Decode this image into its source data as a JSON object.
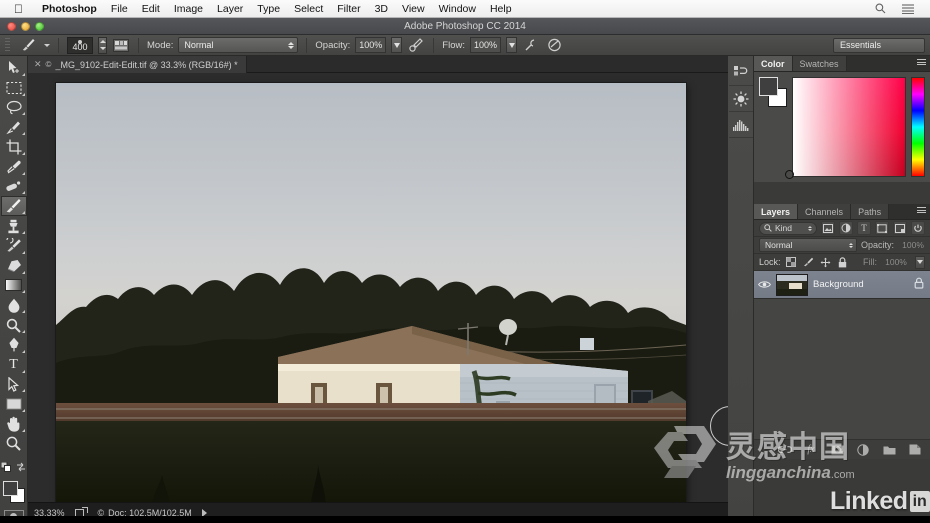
{
  "menubar": {
    "apple_icon": "apple-icon",
    "items": [
      "Photoshop",
      "File",
      "Edit",
      "Image",
      "Layer",
      "Type",
      "Select",
      "Filter",
      "3D",
      "View",
      "Window",
      "Help"
    ],
    "right_icons": [
      "search-icon",
      "list-menu-icon"
    ]
  },
  "window": {
    "title": "Adobe Photoshop CC 2014",
    "traffic_lights": [
      "close-button",
      "minimize-button",
      "zoom-button"
    ]
  },
  "options_bar": {
    "tool_icon": "brush-tool-icon",
    "brush_size": "400",
    "brush_preset_icon": "brush-preset-panel-icon",
    "mode_label": "Mode:",
    "mode_value": "Normal",
    "opacity_label": "Opacity:",
    "opacity_value": "100%",
    "pressure_opacity_icon": "airbrush-pressure-opacity-icon",
    "flow_label": "Flow:",
    "flow_value": "100%",
    "airbrush_icon": "airbrush-icon",
    "smoothing_icon": "pressure-size-icon",
    "workspace": "Essentials"
  },
  "document_tab": {
    "close_icon": "close-tab-icon",
    "copyright_mark": "©",
    "title": "_MG_9102-Edit-Edit.tif @ 33.3% (RGB/16#) *"
  },
  "tools": [
    {
      "name": "move-tool",
      "glyph": "move",
      "selected": false
    },
    {
      "name": "rectangular-marquee-tool",
      "glyph": "marquee",
      "selected": false
    },
    {
      "name": "lasso-tool",
      "glyph": "lasso",
      "selected": false
    },
    {
      "name": "quick-selection-tool",
      "glyph": "quickselect",
      "selected": false
    },
    {
      "name": "crop-tool",
      "glyph": "crop",
      "selected": false
    },
    {
      "name": "eyedropper-tool",
      "glyph": "eyedropper",
      "selected": false
    },
    {
      "name": "spot-healing-brush-tool",
      "glyph": "healing",
      "selected": false
    },
    {
      "name": "brush-tool",
      "glyph": "brush",
      "selected": true
    },
    {
      "name": "clone-stamp-tool",
      "glyph": "stamp",
      "selected": false
    },
    {
      "name": "history-brush-tool",
      "glyph": "historybrush",
      "selected": false
    },
    {
      "name": "eraser-tool",
      "glyph": "eraser",
      "selected": false
    },
    {
      "name": "gradient-tool",
      "glyph": "gradient",
      "selected": false
    },
    {
      "name": "blur-tool",
      "glyph": "blur",
      "selected": false
    },
    {
      "name": "dodge-tool",
      "glyph": "dodge",
      "selected": false
    },
    {
      "name": "pen-tool",
      "glyph": "pen",
      "selected": false
    },
    {
      "name": "horizontal-type-tool",
      "glyph": "type",
      "selected": false
    },
    {
      "name": "path-selection-tool",
      "glyph": "pathselect",
      "selected": false
    },
    {
      "name": "rectangle-tool",
      "glyph": "shape",
      "selected": false
    },
    {
      "name": "hand-tool",
      "glyph": "hand",
      "selected": false
    },
    {
      "name": "zoom-tool",
      "glyph": "zoom",
      "selected": false
    }
  ],
  "tool_footer": {
    "default_colors_icon": "default-colors-icon",
    "swap_colors_icon": "swap-colors-icon",
    "foreground_color": "#3f3f3f",
    "background_color": "#ffffff",
    "quick_mask_icon": "quick-mask-mode-icon"
  },
  "status_bar": {
    "zoom": "33.33%",
    "proxy_icon": "screen-mode-icon",
    "doc_mark": "©",
    "doc_info": "Doc: 102.5M/102.5M",
    "expand_icon": "status-expand-arrow-icon"
  },
  "mini_dock": [
    {
      "name": "history-panel-icon"
    },
    {
      "name": "adjustments-panel-icon"
    },
    {
      "name": "histogram-panel-icon"
    }
  ],
  "color_panel": {
    "tabs": [
      {
        "label": "Color",
        "active": true
      },
      {
        "label": "Swatches",
        "active": false
      }
    ],
    "menu_icon": "panel-menu-icon",
    "foreground_color": "#3f3f3f",
    "background_color": "#ffffff",
    "picker_type": "hue-ramp-square"
  },
  "layers_panel": {
    "tabs": [
      {
        "label": "Layers",
        "active": true
      },
      {
        "label": "Channels",
        "active": false
      },
      {
        "label": "Paths",
        "active": false
      }
    ],
    "menu_icon": "panel-menu-icon",
    "filter_label": "Kind",
    "filter_search_icon": "filter-search-icon",
    "filter_buttons": [
      "pixel-layers-filter-icon",
      "adjustment-layers-filter-icon",
      "type-layers-filter-icon",
      "shape-layers-filter-icon",
      "smart-object-filter-icon"
    ],
    "filter_toggle_icon": "filter-power-toggle-icon",
    "blend_mode": "Normal",
    "opacity_label": "Opacity:",
    "opacity_value": "100%",
    "lock_label": "Lock:",
    "lock_icons": [
      "lock-transparent-pixels-icon",
      "lock-image-pixels-icon",
      "lock-position-icon",
      "lock-all-icon"
    ],
    "fill_label": "Fill:",
    "fill_value": "100%",
    "layers": [
      {
        "name": "Background",
        "visible": true,
        "visibility_icon": "eye-icon",
        "lock_icon": "lock-icon",
        "thumbnail": "photo-thumbnail"
      }
    ],
    "footer_icons": [
      "link-layers-icon",
      "layer-style-fx-icon",
      "add-layer-mask-icon",
      "new-adjustment-layer-icon",
      "new-group-icon",
      "new-layer-icon"
    ]
  },
  "canvas": {
    "brush_cursor": "brush-cursor-circle",
    "image_description": "single-story white house with brown roof beside railroad tracks at dusk"
  },
  "watermarks": {
    "lingan_logo_icon": "lingganchina-logo-icon",
    "lingan_zh": "灵感中国",
    "lingan_en": "lingganchina",
    "lingan_tld": ".com",
    "linkedin_text": "Linked",
    "linkedin_box": "in"
  },
  "colors": {
    "chrome_dark": "#3b3b39",
    "chrome_mid": "#4a4a48",
    "canvas_bg": "#2c2c2c",
    "layer_selected": "#7d8490",
    "accent_red": "#ff0030"
  }
}
